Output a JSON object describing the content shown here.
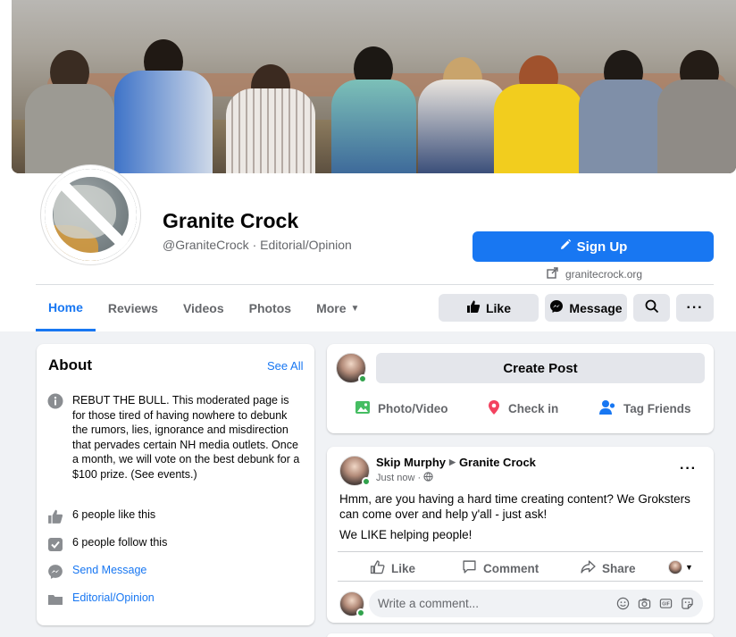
{
  "page": {
    "name": "Granite Crock",
    "handle_category": "@GraniteCrock · Editorial/Opinion",
    "signup_label": "Sign Up",
    "website": "granitecrock.org"
  },
  "tabs": [
    "Home",
    "Reviews",
    "Videos",
    "Photos",
    "More"
  ],
  "actions": {
    "like": "Like",
    "message": "Message"
  },
  "about": {
    "title": "About",
    "see_all": "See All",
    "description": "REBUT THE BULL. This moderated page is for those tired of having nowhere to debunk the rumors, lies, ignorance and misdirection that pervades certain NH media outlets. Once a month, we will vote on the best debunk for a $100 prize. (See events.)",
    "likes": "6 people like this",
    "follows": "6 people follow this",
    "send_message": "Send Message",
    "category": "Editorial/Opinion"
  },
  "create_post": {
    "button": "Create Post",
    "photo_video": "Photo/Video",
    "check_in": "Check in",
    "tag_friends": "Tag Friends"
  },
  "post": {
    "author": "Skip Murphy",
    "target": "Granite Crock",
    "time": "Just now ·",
    "text": "Hmm, are you having a hard time creating content?  We Groksters can come over and help y'all - just ask!",
    "text2": "We LIKE helping people!",
    "like": "Like",
    "comment": "Comment",
    "share": "Share",
    "comment_placeholder": "Write a comment..."
  },
  "colors": {
    "accent": "#1877f2",
    "background": "#f0f2f5",
    "button_gray": "#e4e6eb",
    "online": "#31a24c"
  }
}
